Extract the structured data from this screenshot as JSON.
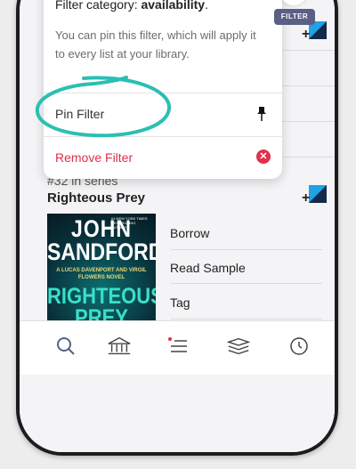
{
  "popover": {
    "title_prefix": "Filter category: ",
    "title_value": "availability",
    "title_suffix": ".",
    "description": "You can pin this filter, which will apply it to every list at your library.",
    "pin_label": "Pin Filter",
    "remove_label": "Remove Filter",
    "remove_icon_glyph": "✕"
  },
  "filter_chip": {
    "label": "FILTER"
  },
  "book": {
    "series": "#32 in series",
    "title": "Righteous Prey",
    "cover": {
      "author_line1": "JOHN",
      "author_line2": "SANDFORD",
      "subtitle": "A LUCAS DAVENPORT AND VIRGIL FLOWERS NOVEL",
      "title_line1": "RIGHTEOUS",
      "title_line2": "PREY",
      "tagline": "#1 NEW YORK TIMES BESTSELLING AUTHOR"
    },
    "actions": [
      "Borrow",
      "Read Sample",
      "Tag"
    ]
  },
  "add_to_list": {
    "plus": "+"
  },
  "nav": {
    "items": [
      "search-icon",
      "library-icon",
      "menu-icon",
      "shelf-icon",
      "clock-icon"
    ],
    "accent_color": "#5a5f86",
    "dot_color": "#e0304a"
  },
  "annotation": {
    "color": "#2bbfb3"
  }
}
